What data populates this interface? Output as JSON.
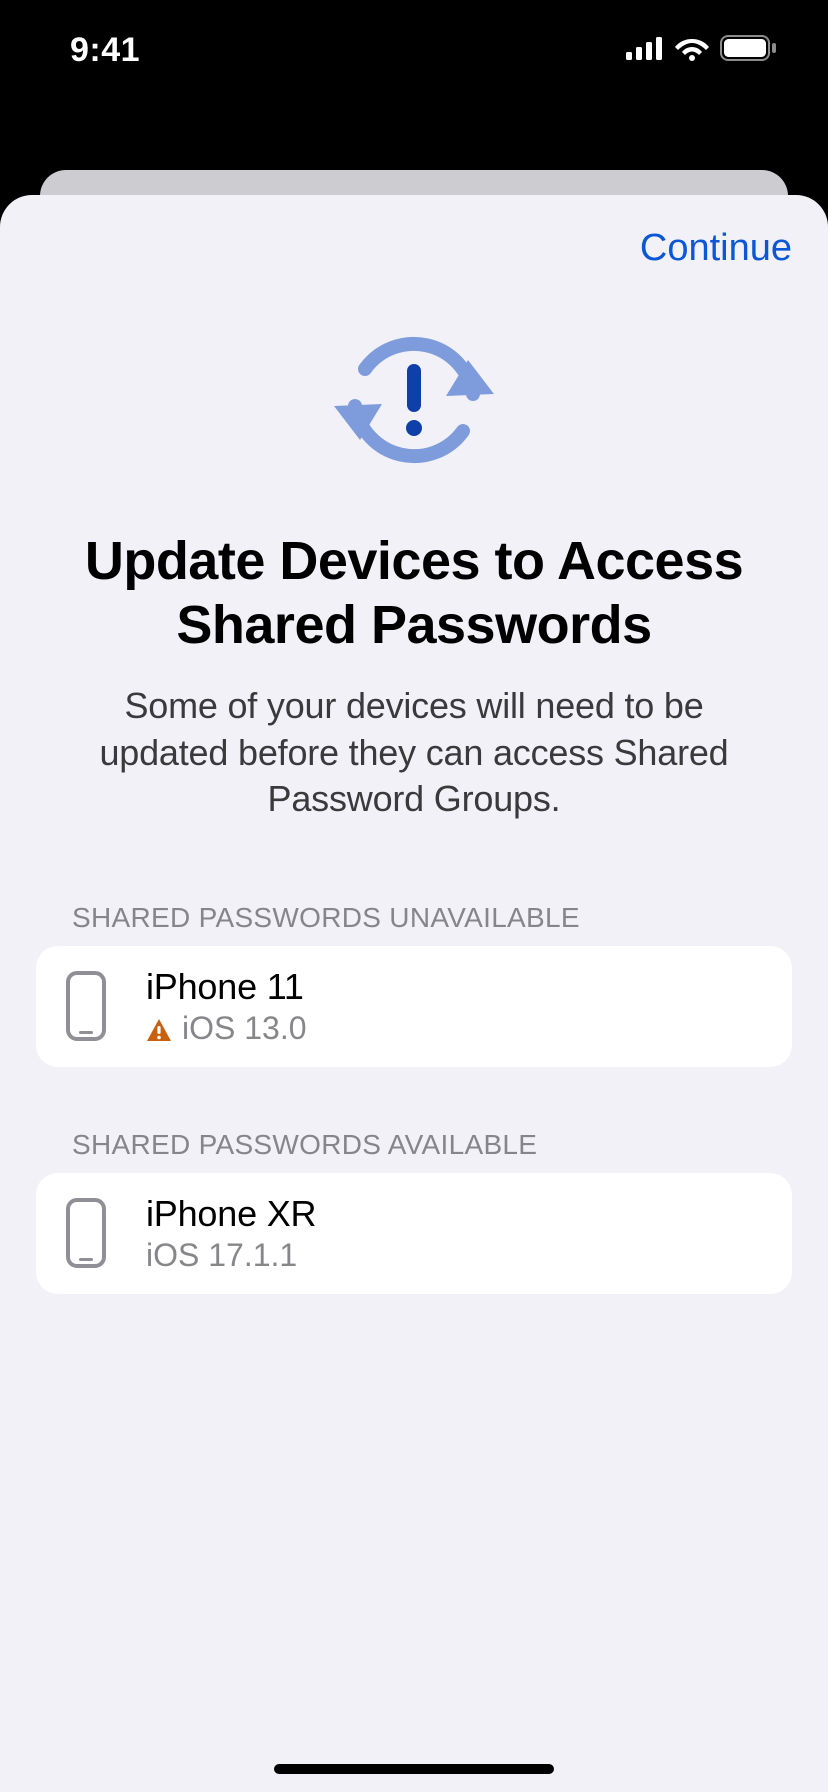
{
  "statusBar": {
    "time": "9:41"
  },
  "sheet": {
    "continueLabel": "Continue",
    "title": "Update Devices to Access Shared Passwords",
    "subtitle": "Some of your devices will need to be updated before they can access Shared Password Groups."
  },
  "sections": {
    "unavailable": {
      "header": "SHARED PASSWORDS UNAVAILABLE",
      "devices": [
        {
          "name": "iPhone 11",
          "os": "iOS 13.0",
          "warn": true
        }
      ]
    },
    "available": {
      "header": "SHARED PASSWORDS AVAILABLE",
      "devices": [
        {
          "name": "iPhone XR",
          "os": "iOS 17.1.1",
          "warn": false
        }
      ]
    }
  }
}
